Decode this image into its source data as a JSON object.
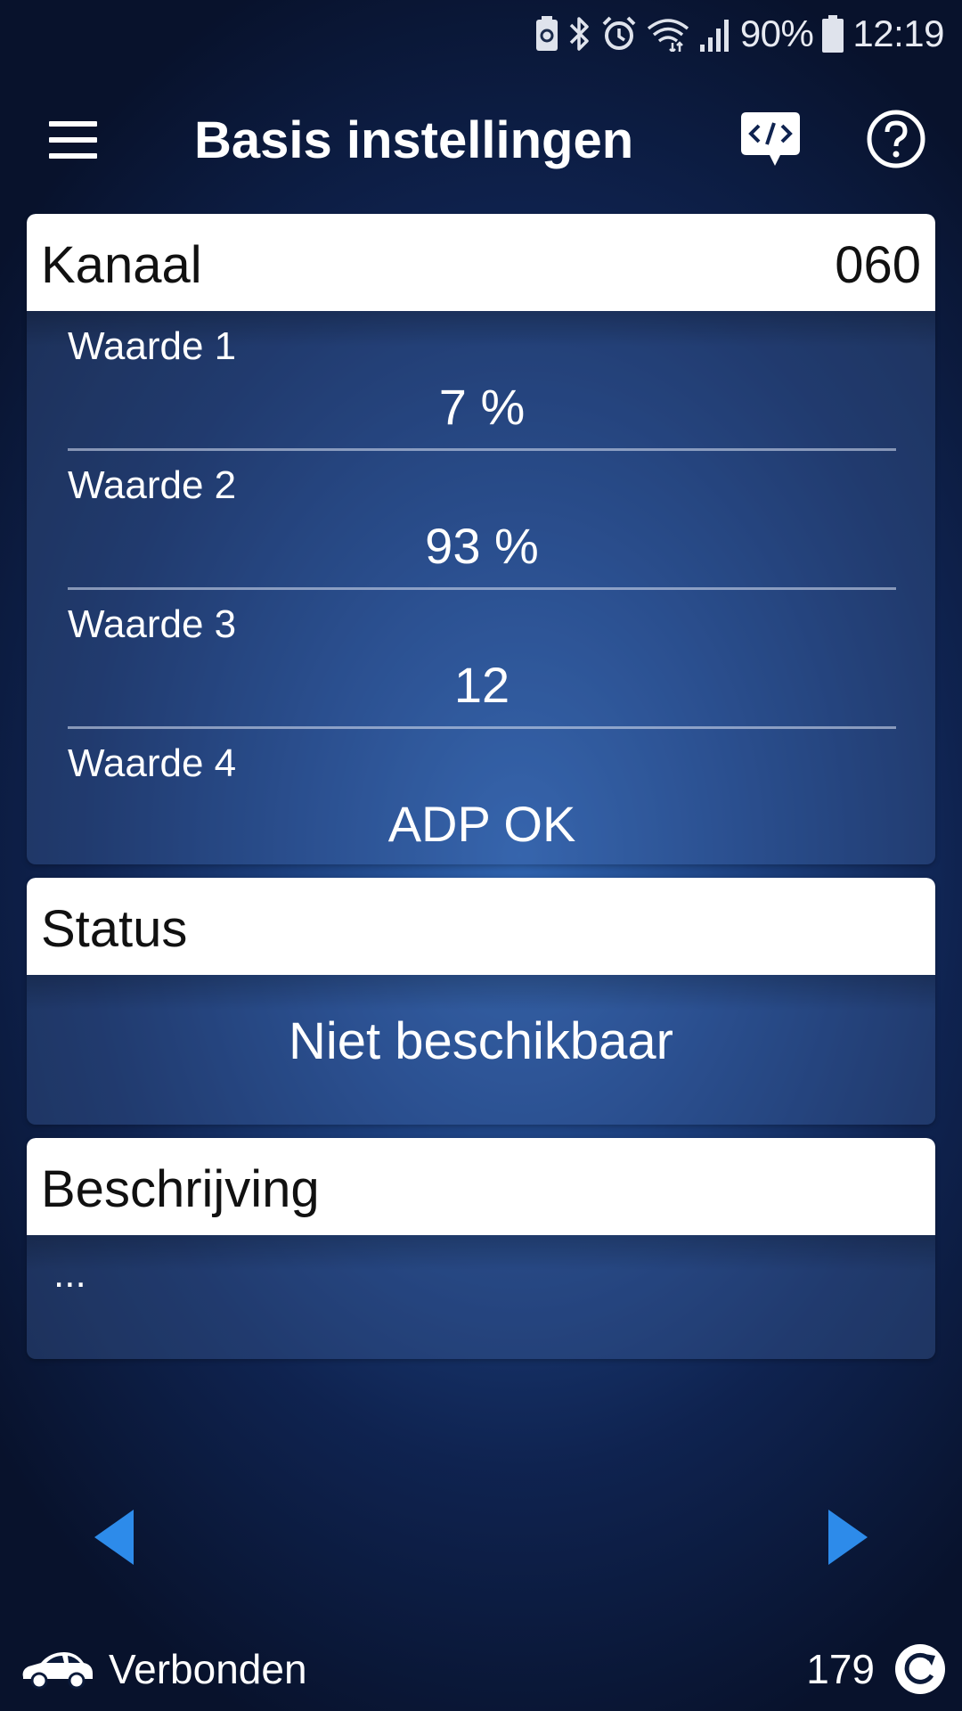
{
  "status_bar": {
    "battery_percent": "90%",
    "time": "12:19",
    "icons": [
      "battery-saver-icon",
      "bluetooth-icon",
      "alarm-icon",
      "wifi-icon",
      "signal-icon",
      "battery-icon"
    ]
  },
  "app_bar": {
    "title": "Basis instellingen",
    "icons": [
      "hamburger-menu-icon",
      "code-chat-icon",
      "help-icon"
    ]
  },
  "kanaal_card": {
    "label": "Kanaal",
    "value": "060",
    "rows": [
      {
        "label": "Waarde 1",
        "value": "7 %"
      },
      {
        "label": "Waarde 2",
        "value": "93 %"
      },
      {
        "label": "Waarde 3",
        "value": "12"
      },
      {
        "label": "Waarde 4",
        "value": "ADP OK"
      }
    ]
  },
  "status_card": {
    "label": "Status",
    "value": "Niet beschikbaar"
  },
  "description_card": {
    "label": "Beschrijving",
    "text": "..."
  },
  "navigation": {
    "icons": [
      "previous-arrow-icon",
      "next-arrow-icon"
    ]
  },
  "bottom_bar": {
    "connection_status": "Verbonden",
    "counter": "179",
    "icons": [
      "car-icon",
      "refresh-icon"
    ]
  },
  "colors": {
    "accent": "#2d8bea",
    "header_bg": "#ffffff",
    "background_center": "#2f62ad",
    "background_edge": "#08122c"
  }
}
